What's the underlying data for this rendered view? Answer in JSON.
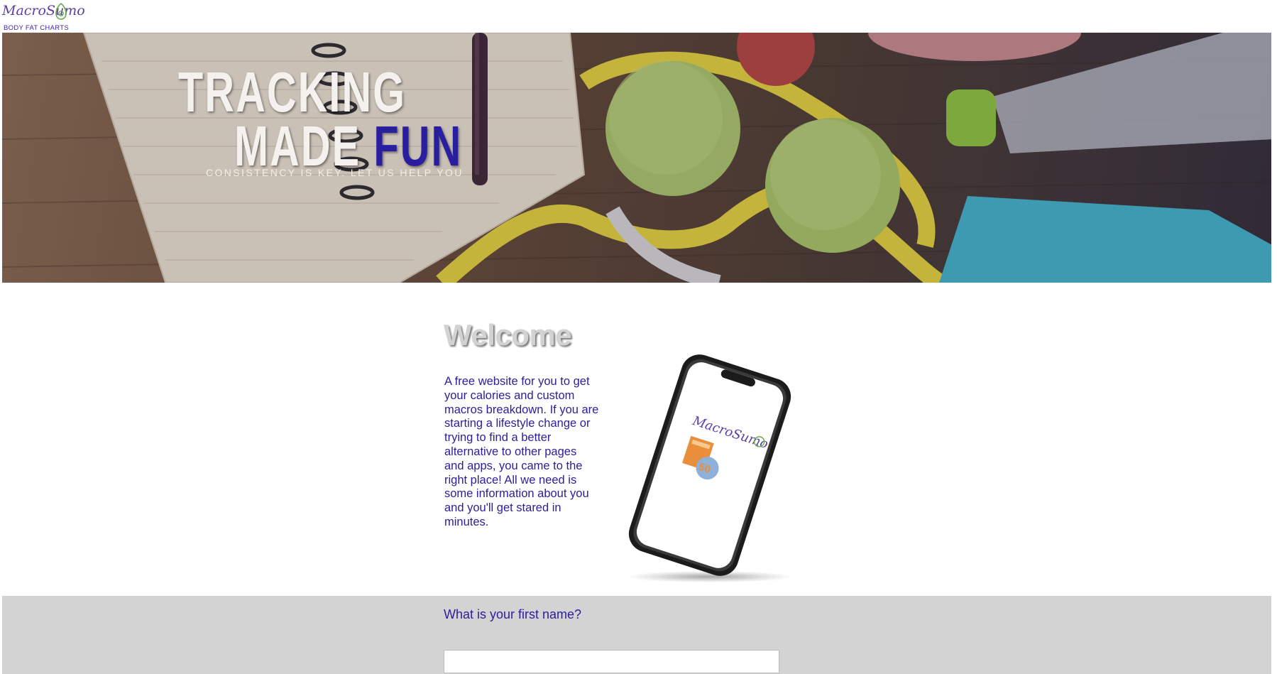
{
  "header": {
    "logo_text": "MacroSumo",
    "logo_subtitle": "BODY FAT CHARTS"
  },
  "hero": {
    "line1": "TRACKING",
    "line2_part1": "MADE ",
    "line2_part2": "FUN",
    "tagline": "CONSISTENCY IS KEY. LET US HELP YOU"
  },
  "welcome": {
    "title": "Welcome",
    "body": "A free website for you to get your calories and custom macros breakdown. If you are starting a lifestyle change or trying to find a better alternative to other pages and apps, you came to the right place! All we need is some information about you and you'll get stared in minutes.",
    "phone_logo_text": "MacroSumo",
    "phone_badge_text": "50"
  },
  "form": {
    "first_name_label": "What is your first name?",
    "first_name_value": ""
  },
  "colors": {
    "brand_purple": "#2a1f9a",
    "logo_purple": "#5b3fa6",
    "avocado_green": "#6aa84f",
    "form_bg": "#d3d3d3"
  },
  "icons": {
    "logo": "avocado-icon",
    "phone": "smartphone-image"
  }
}
